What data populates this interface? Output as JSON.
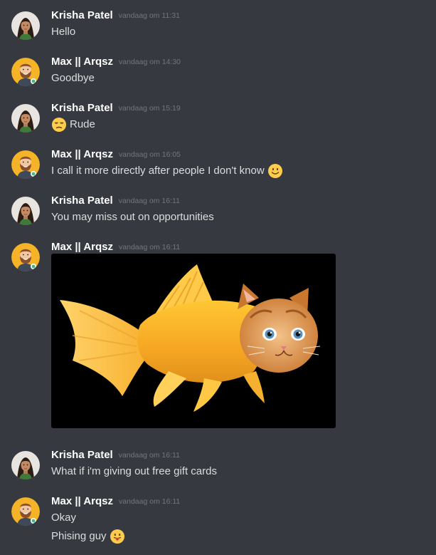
{
  "colors": {
    "background": "#36393f",
    "username": "#ffffff",
    "timestamp": "#72767d",
    "text": "#dcddde"
  },
  "users": {
    "krisha": {
      "name": "Krisha Patel",
      "avatar_icon": "woman-avatar-icon"
    },
    "max": {
      "name": "Max || Arqsz",
      "avatar_icon": "bearded-man-avatar-icon"
    }
  },
  "messages": [
    {
      "author": "Krisha Patel",
      "time": "vandaag om 11:31",
      "lines": [
        {
          "text": "Hello"
        }
      ]
    },
    {
      "author": "Max || Arqsz",
      "time": "vandaag om 14:30",
      "lines": [
        {
          "text": "Goodbye"
        }
      ]
    },
    {
      "author": "Krisha Patel",
      "time": "vandaag om 15:19",
      "lines": [
        {
          "text": "Rude",
          "emoji": "unamused-face-emoji"
        }
      ]
    },
    {
      "author": "Max || Arqsz",
      "time": "vandaag om 16:05",
      "lines": [
        {
          "text": "I call it more directly after people I don't know",
          "emoji": "slightly-smiling-face-emoji"
        }
      ]
    },
    {
      "author": "Krisha Patel",
      "time": "vandaag om 16:11",
      "lines": [
        {
          "text": "You may miss out on opportunities"
        }
      ]
    },
    {
      "author": "Max || Arqsz",
      "time": "vandaag om 16:11",
      "attachment": "goldfish-with-kitten-head-image"
    },
    {
      "author": "Krisha Patel",
      "time": "vandaag om 16:11",
      "lines": [
        {
          "text": "What if i'm giving out free gift cards"
        }
      ]
    },
    {
      "author": "Max || Arqsz",
      "time": "vandaag om 16:11",
      "lines": [
        {
          "text": "Okay"
        },
        {
          "text": "Phising guy",
          "emoji": "face-with-tongue-emoji"
        }
      ]
    }
  ]
}
